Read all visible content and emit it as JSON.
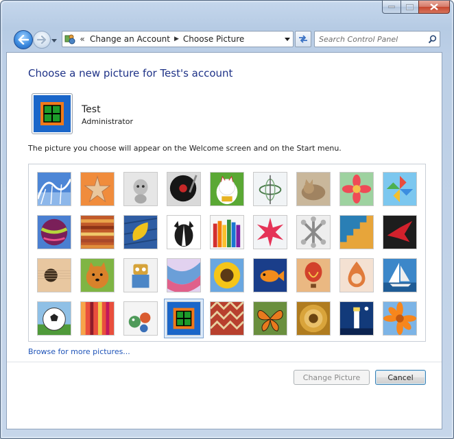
{
  "window": {
    "title_caption_buttons": [
      "minimize",
      "maximize",
      "close"
    ]
  },
  "nav": {
    "back_icon": "back-arrow-icon",
    "forward_icon": "forward-arrow-icon",
    "breadcrumbs": [
      "Change an Account",
      "Choose Picture"
    ],
    "overflow_chevron": "«",
    "search_placeholder": "Search Control Panel"
  },
  "main": {
    "heading": "Choose a new picture for Test's account",
    "user": {
      "name": "Test",
      "role": "Administrator"
    },
    "description": "The picture you choose will appear on the Welcome screen and on the Start menu.",
    "pictures": [
      {
        "icon": "roller-coaster-icon",
        "selected": false
      },
      {
        "icon": "starfish-icon",
        "selected": false
      },
      {
        "icon": "robot-dog-icon",
        "selected": false
      },
      {
        "icon": "record-player-icon",
        "selected": false
      },
      {
        "icon": "lucky-cat-icon",
        "selected": false
      },
      {
        "icon": "gyroscope-icon",
        "selected": false
      },
      {
        "icon": "kitten-icon",
        "selected": false
      },
      {
        "icon": "flower-icon",
        "selected": false
      },
      {
        "icon": "pinwheel-icon",
        "selected": false
      },
      {
        "icon": "ball-icon",
        "selected": false
      },
      {
        "icon": "fabric-icon",
        "selected": false
      },
      {
        "icon": "leaf-icon",
        "selected": false
      },
      {
        "icon": "dog-icon",
        "selected": false
      },
      {
        "icon": "crayons-icon",
        "selected": false
      },
      {
        "icon": "star-ornament-icon",
        "selected": false
      },
      {
        "icon": "jacks-icon",
        "selected": false
      },
      {
        "icon": "stairs-icon",
        "selected": false
      },
      {
        "icon": "origami-crane-icon",
        "selected": false
      },
      {
        "icon": "guitar-icon",
        "selected": false
      },
      {
        "icon": "pomeranian-icon",
        "selected": false
      },
      {
        "icon": "toy-robot-icon",
        "selected": false
      },
      {
        "icon": "scarf-icon",
        "selected": false
      },
      {
        "icon": "sunflower-icon",
        "selected": false
      },
      {
        "icon": "fish-icon",
        "selected": false
      },
      {
        "icon": "hot-air-balloon-icon",
        "selected": false
      },
      {
        "icon": "doll-icon",
        "selected": false
      },
      {
        "icon": "sailboat-icon",
        "selected": false
      },
      {
        "icon": "soccer-ball-icon",
        "selected": false
      },
      {
        "icon": "striped-fabric-icon",
        "selected": false
      },
      {
        "icon": "marbles-icon",
        "selected": false
      },
      {
        "icon": "window-frame-icon",
        "selected": true
      },
      {
        "icon": "rug-icon",
        "selected": false
      },
      {
        "icon": "butterfly-icon",
        "selected": false
      },
      {
        "icon": "shell-spiral-icon",
        "selected": false
      },
      {
        "icon": "lighthouse-icon",
        "selected": false
      },
      {
        "icon": "orange-flower-icon",
        "selected": false
      }
    ],
    "browse_link": "Browse for more pictures...",
    "buttons": {
      "change": "Change Picture",
      "cancel": "Cancel"
    }
  }
}
